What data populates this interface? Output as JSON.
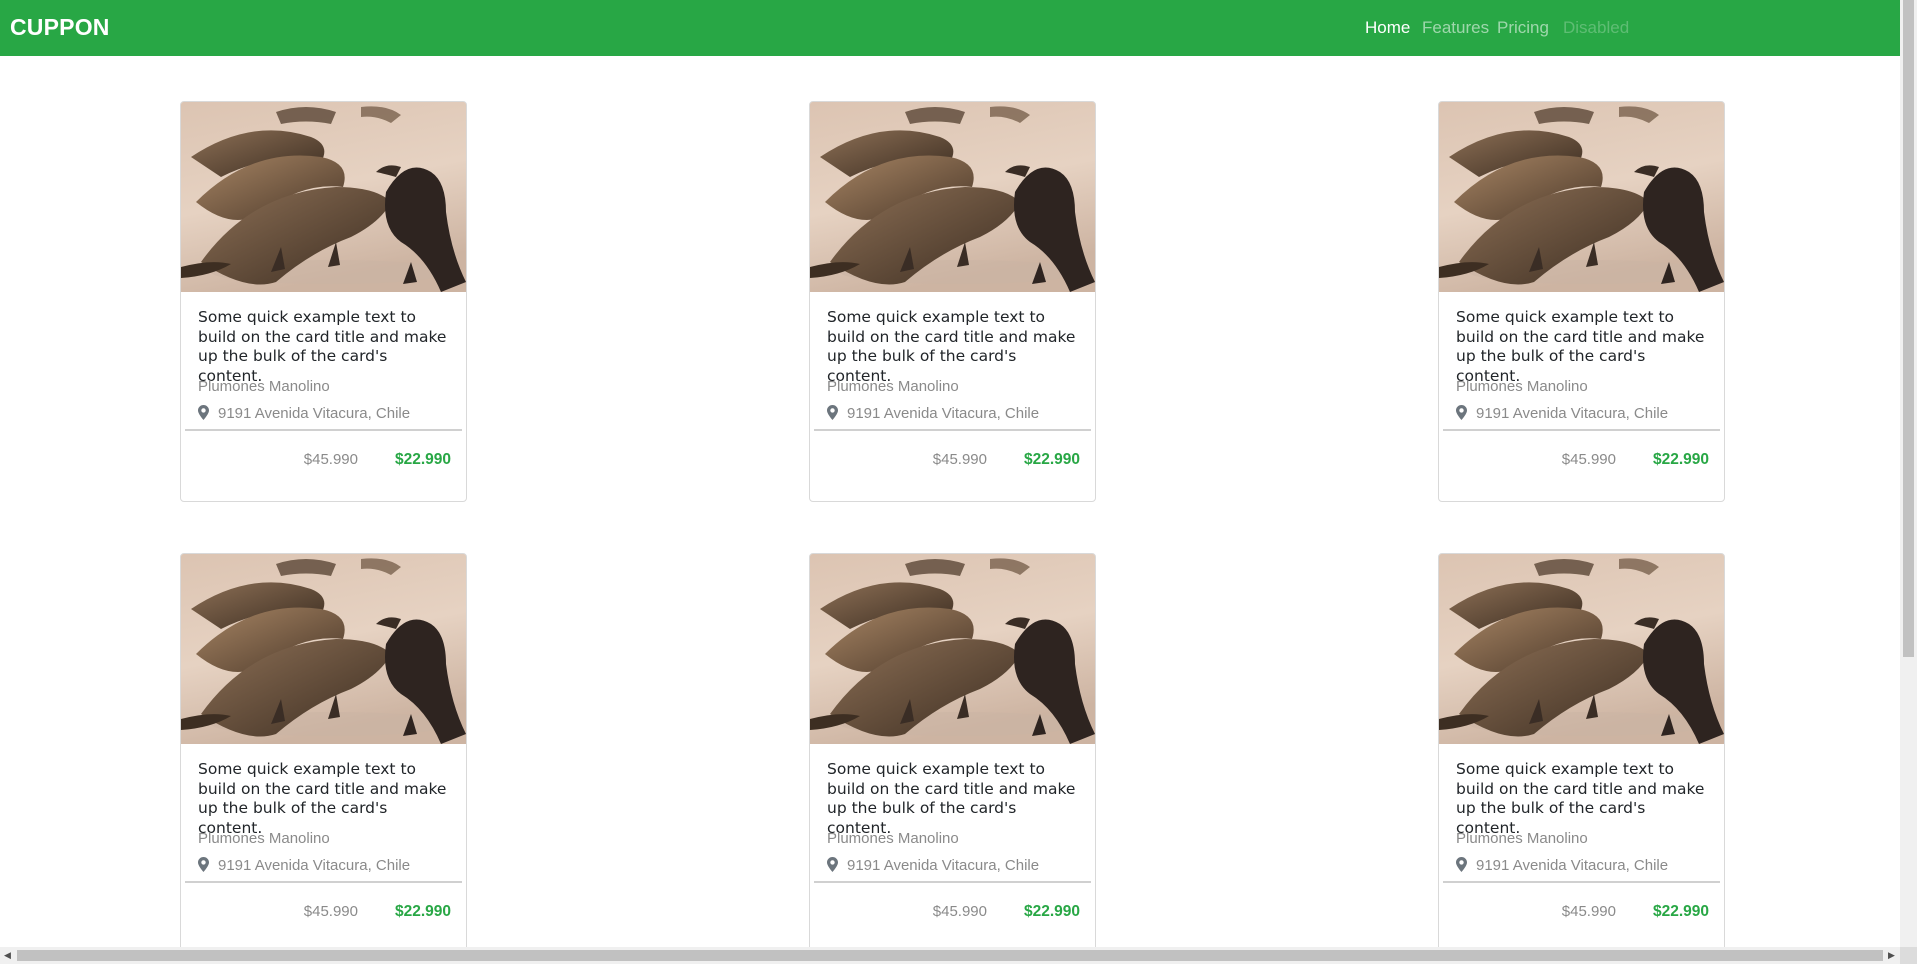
{
  "navbar": {
    "brand": "CUPPON",
    "color": "#28a745",
    "items": [
      {
        "label": "Home",
        "state": "active"
      },
      {
        "label": "Features",
        "state": "normal"
      },
      {
        "label": "Pricing",
        "state": "normal"
      },
      {
        "label": "Disabled",
        "state": "disabled"
      }
    ]
  },
  "cards": [
    {
      "title": "Some quick example text to build on the card title and make up the bulk of the card's content.",
      "store": "Plumones Manolino",
      "location": "9191 Avenida Vitacura, Chile",
      "old_price": "$45.990",
      "new_price": "$22.990",
      "icon": "location-pin-icon"
    },
    {
      "title": "Some quick example text to build on the card title and make up the bulk of the card's content.",
      "store": "Plumones Manolino",
      "location": "9191 Avenida Vitacura, Chile",
      "old_price": "$45.990",
      "new_price": "$22.990",
      "icon": "location-pin-icon"
    },
    {
      "title": "Some quick example text to build on the card title and make up the bulk of the card's content.",
      "store": "Plumones Manolino",
      "location": "9191 Avenida Vitacura, Chile",
      "old_price": "$45.990",
      "new_price": "$22.990",
      "icon": "location-pin-icon"
    },
    {
      "title": "Some quick example text to build on the card title and make up the bulk of the card's content.",
      "store": "Plumones Manolino",
      "location": "9191 Avenida Vitacura, Chile",
      "old_price": "$45.990",
      "new_price": "$22.990",
      "icon": "location-pin-icon"
    },
    {
      "title": "Some quick example text to build on the card title and make up the bulk of the card's content.",
      "store": "Plumones Manolino",
      "location": "9191 Avenida Vitacura, Chile",
      "old_price": "$45.990",
      "new_price": "$22.990",
      "icon": "location-pin-icon"
    },
    {
      "title": "Some quick example text to build on the card title and make up the bulk of the card's content.",
      "store": "Plumones Manolino",
      "location": "9191 Avenida Vitacura, Chile",
      "old_price": "$45.990",
      "new_price": "$22.990",
      "icon": "location-pin-icon"
    }
  ]
}
